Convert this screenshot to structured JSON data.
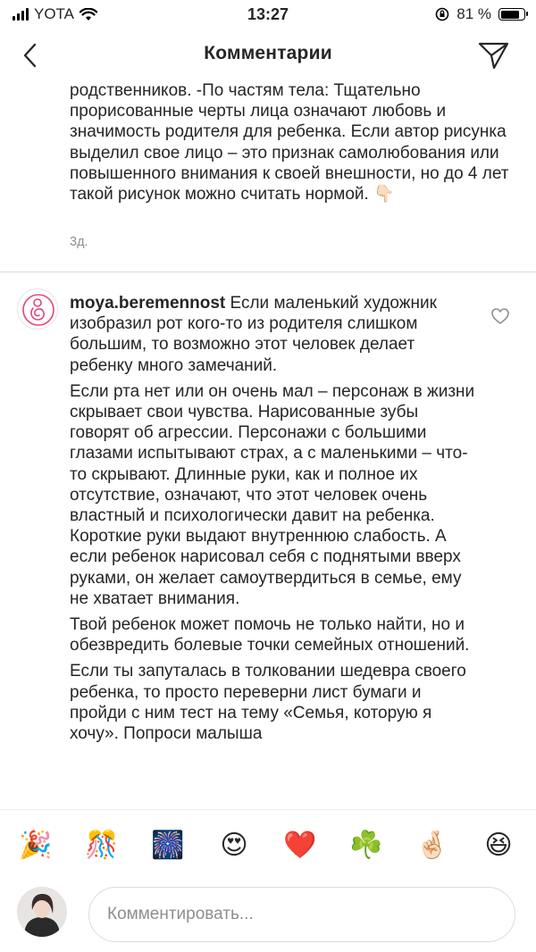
{
  "status_bar": {
    "carrier": "YOTA",
    "time": "13:27",
    "battery_percent": "81 %",
    "battery_level": 0.81
  },
  "header": {
    "title": "Комментарии",
    "back_icon": "chevron-left-icon",
    "send_icon": "paper-plane-icon"
  },
  "previous_comment": {
    "text": "родственников. -По частям тела: Тщательно прорисованные черты лица означают любовь и значимость родителя для ребенка. Если автор рисунка выделил свое лицо – это признак самолюбования или повышенного внимания к своей внешности, но до 4 лет такой рисунок можно считать нормой. 👇🏻",
    "time": "3д."
  },
  "comment": {
    "username": "moya.beremennost",
    "paragraphs": [
      "Если маленький художник изобразил рот кого-то из родителя слишком большим, то возможно этот человек делает ребенку много замечаний.",
      "Если рта нет или он очень мал – персонаж в жизни скрывает свои чувства. Нарисованные зубы говорят об агрессии. Персонажи с большими глазами испытывают страх, а с маленькими – что-то скрывают. Длинные руки, как и полное их отсутствие, означают, что этот человек очень властный и психологически давит на ребенка. Короткие руки выдают внутреннюю слабость. А если ребенок нарисовал себя с поднятыми вверх руками, он желает самоутвердиться в семье, ему не хватает внимания.",
      "Твой ребенок может помочь не только найти, но и обезвредить болевые точки семейных отношений.",
      "Если ты запуталась в толковании шедевра своего ребенка, то просто переверни лист бумаги и пройди с ним тест на тему «Семья, которую я хочу». Попроси малыша"
    ]
  },
  "emoji_bar": [
    "🎉",
    "🎊",
    "🎆",
    "😍",
    "❤️",
    "☘️",
    "🤞🏻",
    "😆"
  ],
  "input": {
    "placeholder": "Комментировать..."
  },
  "colors": {
    "text": "#262626",
    "secondary": "#8e8e8e",
    "divider": "#dbdbdb",
    "avatar_accent": "#e0457b"
  }
}
